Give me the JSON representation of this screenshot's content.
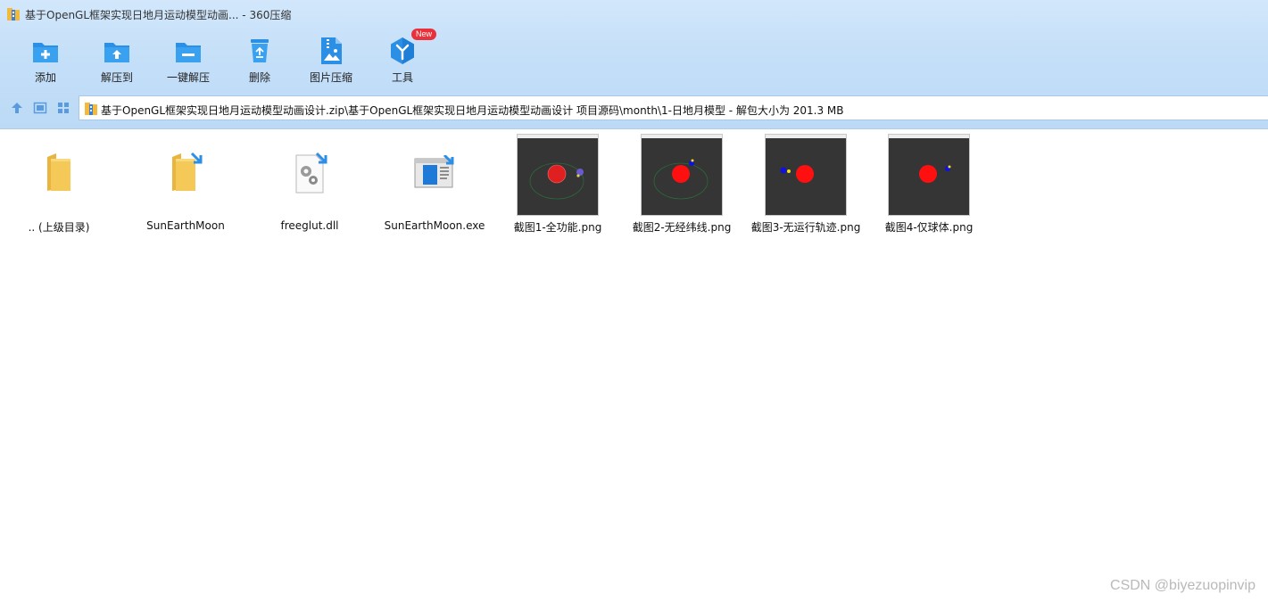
{
  "window": {
    "title": "基于OpenGL框架实现日地月运动模型动画... - 360压缩"
  },
  "toolbar": {
    "items": [
      {
        "label": "添加",
        "icon": "add-folder-icon"
      },
      {
        "label": "解压到",
        "icon": "extract-to-icon"
      },
      {
        "label": "一键解压",
        "icon": "one-click-extract-icon"
      },
      {
        "label": "删除",
        "icon": "recycle-bin-icon"
      },
      {
        "label": "图片压缩",
        "icon": "image-compress-icon"
      },
      {
        "label": "工具",
        "icon": "tools-icon",
        "badge": "New"
      }
    ]
  },
  "address": {
    "path": "基于OpenGL框架实现日地月运动模型动画设计.zip\\基于OpenGL框架实现日地月运动模型动画设计 项目源码\\month\\1-日地月模型 - 解包大小为 201.3 MB"
  },
  "files": [
    {
      "name": ".. (上级目录)",
      "type": "parent-folder"
    },
    {
      "name": "SunEarthMoon",
      "type": "folder"
    },
    {
      "name": "freeglut.dll",
      "type": "dll"
    },
    {
      "name": "SunEarthMoon.exe",
      "type": "exe"
    },
    {
      "name": "截图1-全功能.png",
      "type": "png"
    },
    {
      "name": "截图2-无经纬线.png",
      "type": "png"
    },
    {
      "name": "截图3-无运行轨迹.png",
      "type": "png"
    },
    {
      "name": "截图4-仅球体.png",
      "type": "png"
    }
  ],
  "watermark": "CSDN @biyezuopinvip",
  "colors": {
    "chrome_top": "#d2e7fb",
    "chrome_bottom": "#bcdaf6",
    "accent_blue": "#2c8fe6",
    "badge_red": "#e8313a",
    "folder_yellow": "#f5c957",
    "thumb_bg": "#353535"
  }
}
